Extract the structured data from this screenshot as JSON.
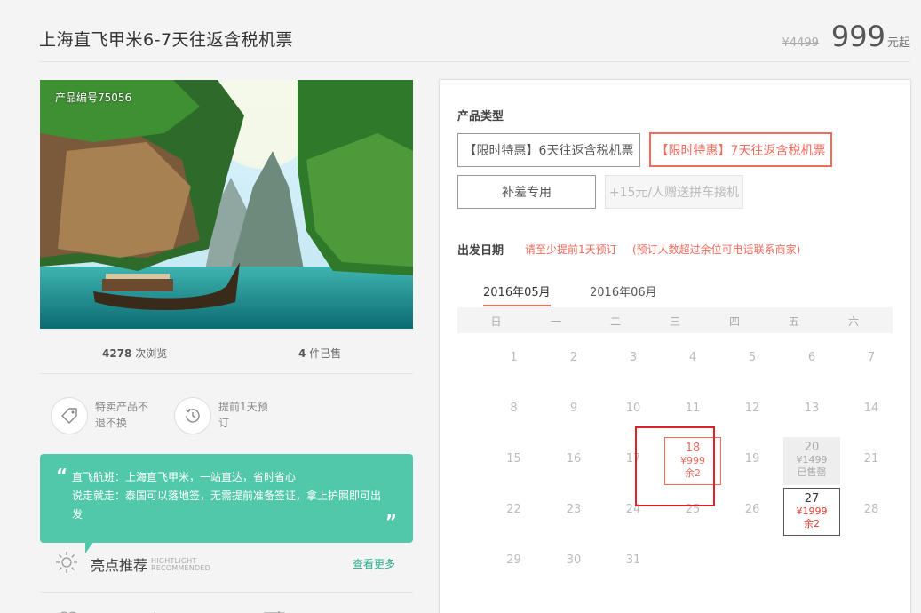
{
  "header": {
    "title": "上海直飞甲米6-7天往返含税机票",
    "old_price": "¥4499",
    "price": "999",
    "price_unit": "元起"
  },
  "gallery": {
    "product_id_label": "产品编号75056"
  },
  "stats": {
    "views_count": "4278",
    "views_label": "次浏览",
    "sold_count": "4",
    "sold_label": "件已售"
  },
  "features": [
    {
      "icon": "tag-icon",
      "label": "特卖产品不退不换"
    },
    {
      "icon": "clock-history-icon",
      "label": "提前1天预订"
    }
  ],
  "intro": {
    "line1": "直飞航班：上海直飞甲米，一站直达，省时省心",
    "line2": "说走就走：泰国可以落地签，无需提前准备签证，拿上护照即可出发"
  },
  "highlights": {
    "title": "亮点推荐",
    "en1": "HIGHTLIGHT",
    "en2": "RECOMMENDED",
    "more_link": "查看更多"
  },
  "product_type": {
    "label": "产品类型",
    "options": [
      {
        "label": "【限时特惠】6天往返含税机票",
        "state": "normal"
      },
      {
        "label": "【限时特惠】7天往返含税机票",
        "state": "active"
      },
      {
        "label": "补差专用",
        "state": "normal"
      },
      {
        "label": "+15元/人赠送拼车接机",
        "state": "disabled"
      }
    ]
  },
  "departure": {
    "label": "出发日期",
    "note1": "请至少提前1天预订",
    "note2": "(预订人数超过余位可电话联系商家)"
  },
  "calendar": {
    "months": [
      "2016年05月",
      "2016年06月"
    ],
    "active_month": 0,
    "weekdays": [
      "日",
      "一",
      "二",
      "三",
      "四",
      "五",
      "六"
    ],
    "weeks": [
      [
        {
          "d": "1"
        },
        {
          "d": "2"
        },
        {
          "d": "3"
        },
        {
          "d": "4"
        },
        {
          "d": "5"
        },
        {
          "d": "6"
        },
        {
          "d": "7"
        }
      ],
      [
        {
          "d": "8"
        },
        {
          "d": "9"
        },
        {
          "d": "10"
        },
        {
          "d": "11"
        },
        {
          "d": "12"
        },
        {
          "d": "13"
        },
        {
          "d": "14"
        }
      ],
      [
        {
          "d": "15"
        },
        {
          "d": "16"
        },
        {
          "d": "17"
        },
        {
          "d": "18",
          "price": "¥999",
          "stock": "余2",
          "state": "sale"
        },
        {
          "d": "19"
        },
        {
          "d": "20",
          "price": "¥1499",
          "stock": "已售罄",
          "state": "soldout"
        },
        {
          "d": "21"
        }
      ],
      [
        {
          "d": "22"
        },
        {
          "d": "23"
        },
        {
          "d": "24"
        },
        {
          "d": "25"
        },
        {
          "d": "26"
        },
        {
          "d": "27",
          "price": "¥1999",
          "stock": "余2",
          "state": "avail"
        },
        {
          "d": "28"
        }
      ],
      [
        {
          "d": "29"
        },
        {
          "d": "30"
        },
        {
          "d": "31"
        }
      ]
    ]
  },
  "colors": {
    "accent": "#f06b5c",
    "green": "#52c8aa",
    "selection": "#d8232a"
  }
}
